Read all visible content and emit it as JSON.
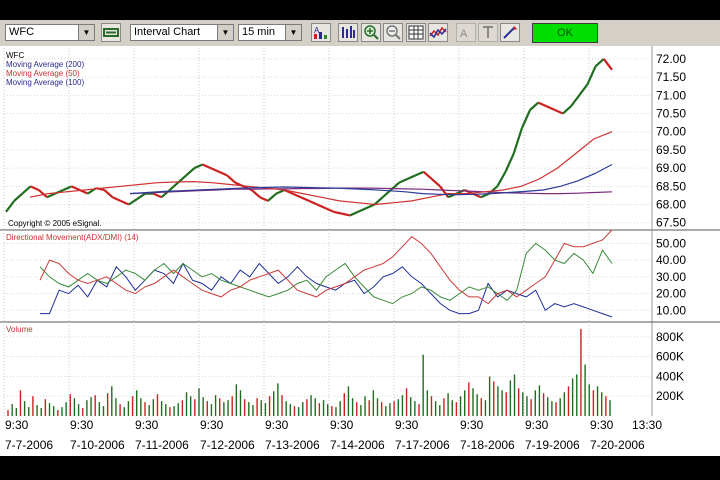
{
  "toolbar": {
    "symbol": "WFC",
    "chart_type": "Interval Chart",
    "interval": "15 min",
    "ok_label": "OK",
    "icons": [
      "link-icon",
      "bar-style-icon",
      "bar-chart-icon",
      "zoom-in-icon",
      "zoom-out-icon",
      "grid-icon",
      "line-study-icon",
      "text-icon",
      "cursor-icon",
      "draw-icon"
    ]
  },
  "chart_data": [
    {
      "type": "line",
      "panel": "price",
      "legend": [
        "WFC",
        "Moving Average (200)",
        "Moving Average (50)",
        "Moving Average (100)"
      ],
      "copyright": "Copyright © 2005 eSignal.",
      "yticks": [
        "72.00",
        "71.50",
        "71.00",
        "70.50",
        "70.00",
        "69.50",
        "69.00",
        "68.50",
        "68.00",
        "67.50"
      ],
      "ylim": [
        67.3,
        72.3
      ],
      "series": [
        {
          "name": "WFC",
          "color": "#1f6e1f",
          "values": [
            67.8,
            68.1,
            68.3,
            68.5,
            68.4,
            68.2,
            68.3,
            68.4,
            68.5,
            68.4,
            68.3,
            68.45,
            68.4,
            68.2,
            68.1,
            68.0,
            68.15,
            68.3,
            68.3,
            68.2,
            68.4,
            68.6,
            68.8,
            69.0,
            69.1,
            69.0,
            68.9,
            68.8,
            68.6,
            68.5,
            68.4,
            68.2,
            68.1,
            68.3,
            68.4,
            68.3,
            68.2,
            68.1,
            68.0,
            67.9,
            67.8,
            67.75,
            67.7,
            67.8,
            67.9,
            68.0,
            68.2,
            68.4,
            68.6,
            68.7,
            68.8,
            68.9,
            68.7,
            68.5,
            68.2,
            68.3,
            68.4,
            68.3,
            68.2,
            68.3,
            68.5,
            68.9,
            69.4,
            70.1,
            70.6,
            70.8,
            70.7,
            70.6,
            70.5,
            70.7,
            71.0,
            71.3,
            71.8,
            72.0,
            71.7
          ],
          "colors_note": ""
        },
        {
          "name": "Moving Average (200)",
          "color": "#7a2a7a",
          "values": [
            68.3,
            68.32,
            68.34,
            68.36,
            68.38,
            68.4,
            68.42,
            68.42,
            68.43,
            68.43,
            68.44,
            68.44,
            68.45,
            68.45,
            68.45,
            68.44,
            68.43,
            68.42,
            68.4,
            68.38,
            68.36,
            68.34,
            68.32,
            68.31,
            68.3,
            68.3,
            68.31,
            68.33,
            68.35
          ]
        },
        {
          "name": "Moving Average (50)",
          "color": "#d03030",
          "values": [
            68.2,
            68.3,
            68.35,
            68.4,
            68.45,
            68.5,
            68.55,
            68.6,
            68.62,
            68.63,
            68.6,
            68.55,
            68.5,
            68.45,
            68.4,
            68.3,
            68.2,
            68.1,
            68.05,
            68.0,
            68.05,
            68.1,
            68.2,
            68.3,
            68.3,
            68.35,
            68.4,
            68.5,
            68.7,
            69.0,
            69.4,
            69.8,
            70.0
          ]
        },
        {
          "name": "Moving Average (100)",
          "color": "#2a3a9a",
          "values": [
            68.3,
            68.33,
            68.36,
            68.38,
            68.4,
            68.42,
            68.44,
            68.46,
            68.47,
            68.48,
            68.47,
            68.46,
            68.45,
            68.43,
            68.41,
            68.38,
            68.35,
            68.3,
            68.28,
            68.27,
            68.28,
            68.3,
            68.33,
            68.36,
            68.4,
            68.5,
            68.65,
            68.85,
            69.1
          ]
        }
      ]
    },
    {
      "type": "line",
      "panel": "dmi",
      "title": "Directional Movement(ADX/DMI) (14)",
      "yticks": [
        "50.00",
        "40.00",
        "30.00",
        "20.00",
        "10.00"
      ],
      "ylim": [
        3,
        58
      ],
      "series": [
        {
          "name": "ADX",
          "color": "#1f2f9a",
          "values": [
            8,
            8,
            22,
            20,
            25,
            18,
            28,
            24,
            36,
            30,
            22,
            28,
            34,
            32,
            26,
            38,
            28,
            26,
            22,
            30,
            26,
            34,
            30,
            38,
            32,
            26,
            30,
            36,
            30,
            26,
            24,
            22,
            26,
            28,
            20,
            24,
            30,
            32,
            36,
            30,
            26,
            20,
            14,
            10,
            8,
            8,
            10,
            26,
            18,
            22,
            20,
            18,
            22,
            10,
            14,
            12,
            14,
            12,
            10,
            8,
            6
          ]
        },
        {
          "name": "+DI",
          "color": "#3a8a3a",
          "values": [
            36,
            30,
            26,
            24,
            28,
            32,
            28,
            26,
            30,
            34,
            32,
            28,
            34,
            38,
            32,
            38,
            34,
            30,
            32,
            28,
            26,
            24,
            22,
            20,
            18,
            20,
            22,
            26,
            28,
            22,
            30,
            34,
            38,
            30,
            24,
            18,
            16,
            14,
            18,
            20,
            24,
            22,
            18,
            16,
            20,
            24,
            22,
            24,
            20,
            16,
            22,
            44,
            50,
            46,
            40,
            38,
            44,
            40,
            32,
            46,
            38
          ]
        },
        {
          "name": "-DI",
          "color": "#cc3a3a",
          "values": [
            28,
            40,
            38,
            32,
            28,
            26,
            28,
            30,
            26,
            22,
            20,
            24,
            26,
            30,
            34,
            30,
            26,
            22,
            20,
            18,
            22,
            24,
            28,
            30,
            32,
            34,
            28,
            22,
            20,
            18,
            22,
            24,
            26,
            30,
            34,
            36,
            38,
            42,
            48,
            54,
            50,
            44,
            36,
            28,
            22,
            18,
            18,
            14,
            20,
            22,
            18,
            22,
            26,
            30,
            40,
            50,
            48,
            48,
            50,
            52,
            58
          ]
        }
      ]
    },
    {
      "type": "bar",
      "panel": "volume",
      "title": "Volume",
      "yticks": [
        "800K",
        "600K",
        "400K",
        "200K"
      ],
      "ylim": [
        0,
        950
      ],
      "values": [
        60,
        120,
        80,
        260,
        150,
        90,
        200,
        110,
        80,
        170,
        130,
        100,
        60,
        90,
        140,
        220,
        180,
        120,
        80,
        160,
        190,
        210,
        140,
        100,
        230,
        300,
        180,
        120,
        90,
        150,
        200,
        260,
        180,
        140,
        110,
        170,
        220,
        150,
        120,
        90,
        100,
        130,
        160,
        240,
        200,
        170,
        280,
        190,
        150,
        120,
        210,
        180,
        140,
        160,
        200,
        320,
        260,
        170,
        140,
        110,
        180,
        160,
        130,
        200,
        250,
        330,
        210,
        150,
        120,
        100,
        90,
        140,
        170,
        210,
        180,
        130,
        160,
        120,
        100,
        90,
        150,
        230,
        300,
        180,
        140,
        110,
        200,
        160,
        260,
        180,
        140,
        100,
        130,
        150,
        170,
        210,
        280,
        190,
        150,
        120,
        620,
        260,
        200,
        150,
        110,
        180,
        230,
        160,
        140,
        200,
        260,
        340,
        280,
        220,
        180,
        160,
        400,
        350,
        300,
        260,
        240,
        360,
        420,
        280,
        240,
        200,
        170,
        260,
        310,
        230,
        190,
        150,
        140,
        180,
        240,
        300,
        380,
        420,
        880,
        520,
        320,
        260,
        300,
        240,
        200,
        160
      ]
    }
  ],
  "xaxis": {
    "time_labels": [
      "9:30",
      "9:30",
      "9:30",
      "9:30",
      "9:30",
      "9:30",
      "9:30",
      "9:30",
      "9:30",
      "9:30",
      "13:30"
    ],
    "date_labels": [
      "7-7-2006",
      "7-10-2006",
      "7-11-2006",
      "7-12-2006",
      "7-13-2006",
      "7-14-2006",
      "7-17-2006",
      "7-18-2006",
      "7-19-2006",
      "7-20-2006"
    ]
  },
  "colors": {
    "ok_button": "#00dd00",
    "price_up": "#1f6e1f",
    "price_down": "#cc2020",
    "background": "#ffffff"
  }
}
